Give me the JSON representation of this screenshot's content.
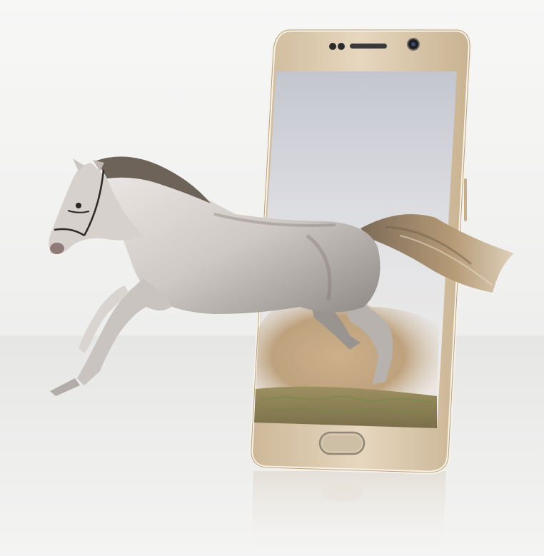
{
  "colors": {
    "background_top": "#f3f3f2",
    "background_bottom": "#e7e7e6",
    "phone_frame": "#dcc9ad",
    "phone_edge": "#f3efe6",
    "screen_sky_top": "#c9cbd3",
    "screen_sky_bottom": "#f1efee",
    "dust": "#b99a72",
    "ground": "#8c8157",
    "horse_body": "#c8c3bf",
    "horse_shadow": "#6a6664",
    "horse_mane": "#6e6359",
    "tail": "#a88f6e"
  },
  "icons": [
    "front-camera-icon",
    "speaker-grille-icon",
    "home-button-icon"
  ]
}
